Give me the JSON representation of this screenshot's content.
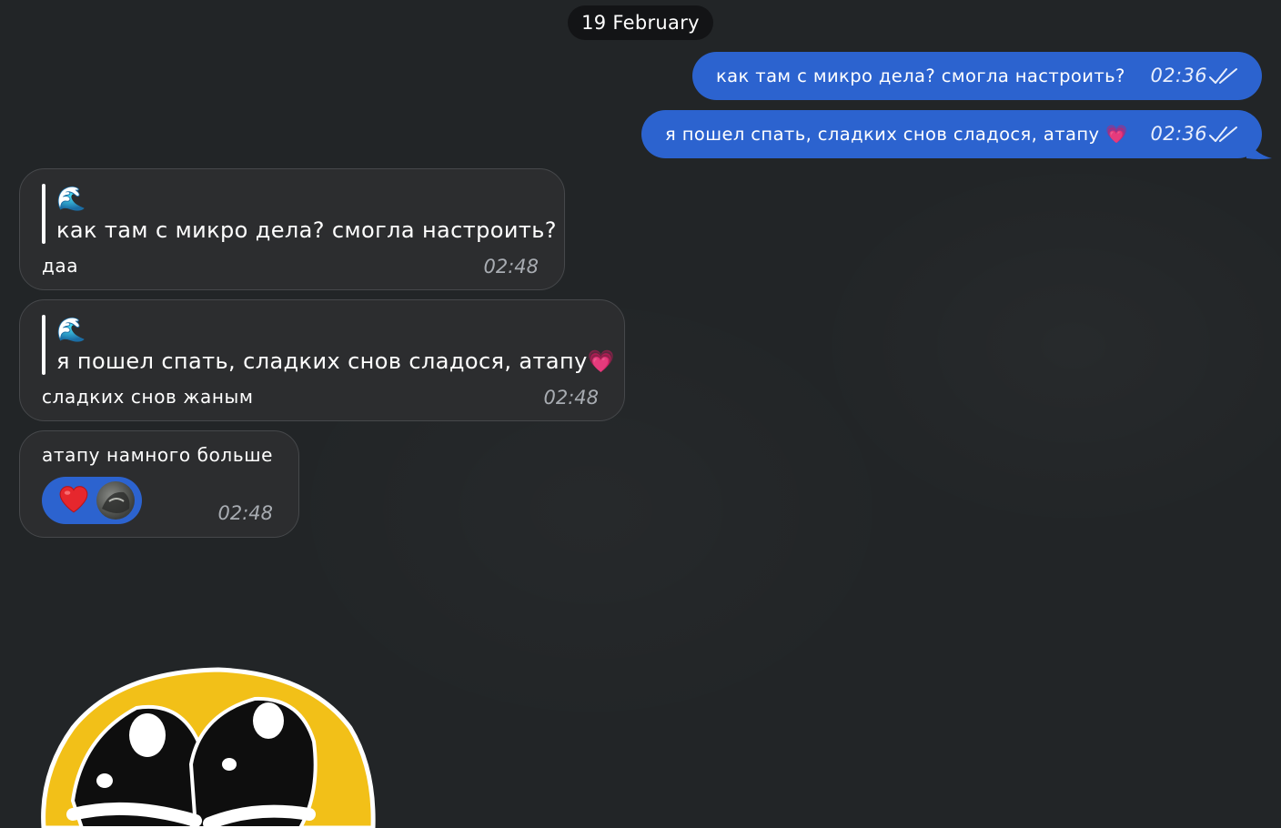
{
  "date_label": "19 February",
  "outgoing": [
    {
      "text": "как там с микро дела? смогла настроить?",
      "time": "02:36"
    },
    {
      "text": "я пошел спать, сладких снов сладося, атапу 💗",
      "time": "02:36"
    }
  ],
  "incoming": [
    {
      "reply_emoji": "🌊",
      "reply_text": "как там с микро дела? смогла настроить?",
      "text": "даа",
      "time": "02:48"
    },
    {
      "reply_emoji": "🌊",
      "reply_text": "я пошел спать, сладких снов сладося, атапу💗",
      "text": "сладких снов жаным",
      "time": "02:48"
    },
    {
      "text": "атапу намного больше",
      "time": "02:48",
      "reaction": "heart-icon"
    }
  ],
  "colors": {
    "outgoing_bubble": "#2c63cf",
    "incoming_bubble": "#2c2d2f",
    "background": "#222527"
  }
}
